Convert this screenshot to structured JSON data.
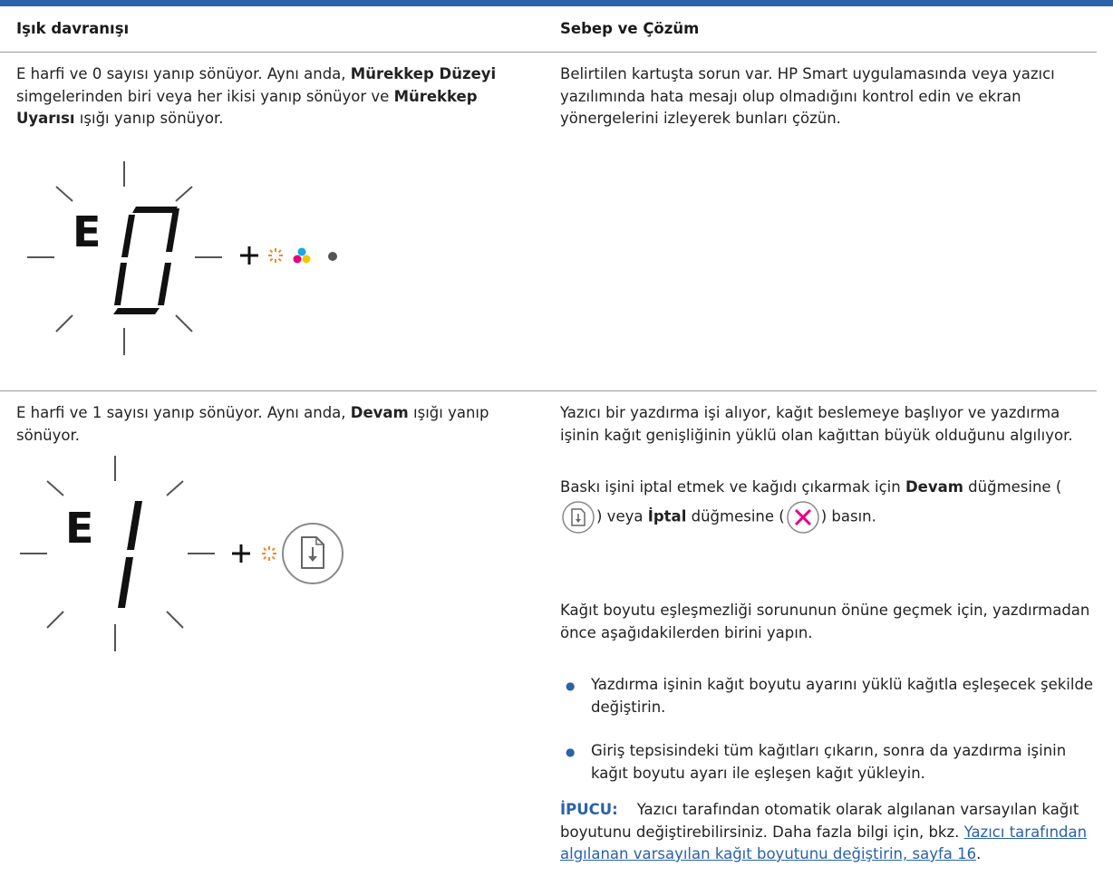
{
  "header": {
    "col1": "Işık davranışı",
    "col2": "Sebep ve Çözüm"
  },
  "row1": {
    "desc": {
      "t1": "E harfi ve 0 sayısı yanıp sönüyor. Aynı anda, ",
      "b1": "Mürekkep Düzeyi",
      "t2": " simgelerinden biri veya her ikisi yanıp sönüyor ve ",
      "b2": "Mürekkep Uyarısı",
      "t3": " ışığı yanıp sönüyor."
    },
    "display": {
      "letter": "E",
      "digit": "0"
    },
    "solution": "Belirtilen kartuşta sorun var. HP Smart uygulamasında veya yazıcı yazılımında hata mesajı olup olmadığını kontrol edin ve ekran yönergelerini izleyerek bunları çözün.",
    "icons": [
      "plus-icon",
      "ink-alert-light-icon",
      "ink-color-icon",
      "ink-black-icon"
    ]
  },
  "row2": {
    "desc": {
      "t1": "E harfi ve 1 sayısı yanıp sönüyor. Aynı anda, ",
      "b1": "Devam",
      "t2": " ışığı yanıp sönüyor."
    },
    "display": {
      "letter": "E",
      "digit": "1"
    },
    "p1": "Yazıcı bir yazdırma işi alıyor, kağıt beslemeye başlıyor ve yazdırma işinin kağıt genişliğinin yüklü olan kağıttan büyük olduğunu algılıyor.",
    "p2": {
      "t1": "Baskı işini iptal etmek ve kağıdı çıkarmak için ",
      "b1": "Devam",
      "t2": " düğmesine (",
      "t3": ") veya ",
      "b2": "İptal",
      "t4": " düğmesine (",
      "t5": ") basın."
    },
    "p3": "Kağıt boyutu eşleşmezliği sorununun önüne geçmek için, yazdırmadan önce aşağıdakilerden birini yapın.",
    "bullets": [
      "Yazdırma işinin kağıt boyutu ayarını yüklü kağıtla eşleşecek şekilde değiştirin.",
      "Giriş tepsisindeki tüm kağıtları çıkarın, sonra da yazdırma işinin kağıt boyutu ayarı ile eşleşen kağıt yükleyin."
    ],
    "tip": {
      "label": "İPUCU:",
      "text": "Yazıcı tarafından otomatik olarak algılanan varsayılan kağıt boyutunu değiştirebilirsiniz. Daha fazla bilgi için, bkz. ",
      "link": "Yazıcı tarafından algılanan varsayılan kağıt boyutunu değiştirin, sayfa 16",
      "end": "."
    },
    "icons": [
      "plus-icon",
      "resume-light-icon",
      "resume-button-icon",
      "cancel-button-icon"
    ]
  },
  "colors": {
    "accent": "#2b62a8",
    "alert": "#f08a24",
    "cancel": "#e6007e"
  }
}
